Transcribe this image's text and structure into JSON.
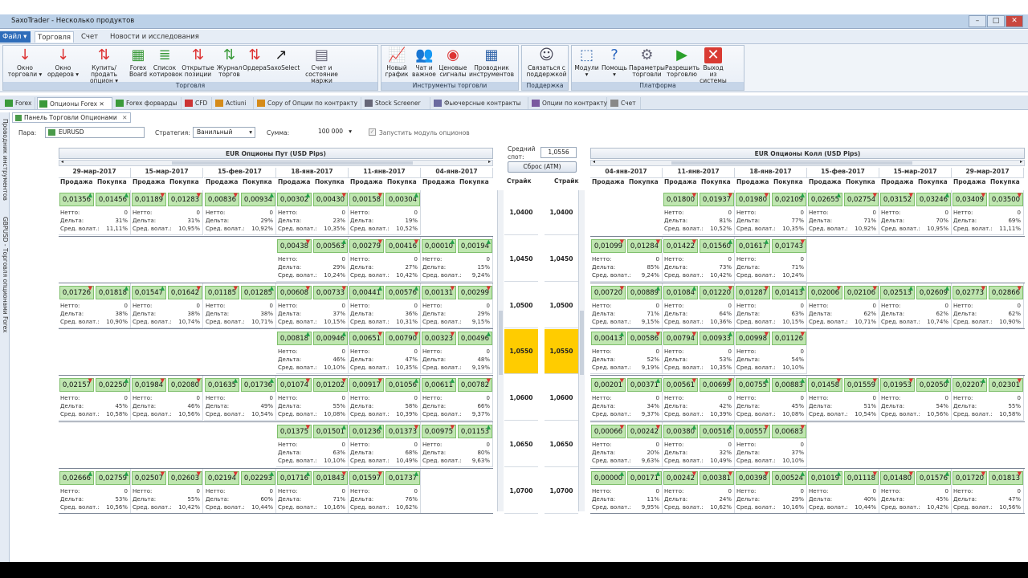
{
  "window": {
    "title": "SaxoTrader - Несколько продуктов"
  },
  "menu": {
    "file": "Файл",
    "items": [
      "Торговля",
      "Счет",
      "Новости и исследования"
    ]
  },
  "ribbon": {
    "groups": [
      {
        "label": "Торговля",
        "buttons": [
          {
            "l1": "Окно",
            "l2": "торговли ▾",
            "icon": "↓",
            "color": "#d33"
          },
          {
            "l1": "Окно",
            "l2": "ордеров ▾",
            "icon": "↓",
            "color": "#d33"
          },
          {
            "l1": "Купить/продать",
            "l2": "опцион ▾",
            "icon": "⇅",
            "color": "#d33"
          },
          {
            "l1": "Forex",
            "l2": "Board",
            "icon": "▦",
            "color": "#3a9a3a"
          },
          {
            "l1": "Список",
            "l2": "котировок",
            "icon": "≣",
            "color": "#3a9a3a"
          },
          {
            "l1": "Открытые",
            "l2": "позиции",
            "icon": "⇅",
            "color": "#d33"
          },
          {
            "l1": "Журнал",
            "l2": "торгов",
            "icon": "⇅",
            "color": "#3a9a3a"
          },
          {
            "l1": "Ордера",
            "l2": "",
            "icon": "⇅",
            "color": "#d33"
          },
          {
            "l1": "SaxoSelect",
            "l2": "",
            "icon": "↗",
            "color": "#222"
          },
          {
            "l1": "Счет и",
            "l2": "состояние маржи",
            "icon": "▤",
            "color": "#667"
          }
        ]
      },
      {
        "label": "Инструменты торговли",
        "buttons": [
          {
            "l1": "Новый",
            "l2": "график",
            "icon": "📈",
            "color": "#c33"
          },
          {
            "l1": "Чат и",
            "l2": "важное",
            "icon": "👥",
            "color": "#444"
          },
          {
            "l1": "Ценовые",
            "l2": "сигналы",
            "icon": "◉",
            "color": "#d33"
          },
          {
            "l1": "Проводник",
            "l2": "инструментов",
            "icon": "▦",
            "color": "#3366aa"
          }
        ]
      },
      {
        "label": "Поддержка",
        "buttons": [
          {
            "l1": "Связаться с",
            "l2": "поддержкой",
            "icon": "☺",
            "color": "#445"
          }
        ]
      },
      {
        "label": "Платформа",
        "buttons": [
          {
            "l1": "Модули",
            "l2": "▾",
            "icon": "⬚",
            "color": "#3366aa"
          },
          {
            "l1": "Помощь",
            "l2": "▾",
            "icon": "?",
            "color": "#2a66c0"
          },
          {
            "l1": "Параметры",
            "l2": "торговли",
            "icon": "⚙",
            "color": "#667"
          },
          {
            "l1": "Разрешить",
            "l2": "торговлю",
            "icon": "▶",
            "color": "#2aa02a"
          },
          {
            "l1": "Выход из",
            "l2": "системы",
            "icon": "✕",
            "color": "#fff"
          }
        ]
      }
    ]
  },
  "tabs": [
    "Forex",
    "Опционы Forex",
    "Forex форварды",
    "CFD",
    "Actiuni",
    "Copy of Опции по контракту",
    "Stock Screener",
    "Фьючерсные контракты",
    "Опции по контракту",
    "Счет"
  ],
  "subtab": "Панель Торговли Опционами",
  "sidebar": {
    "t1": "Проводник инструментов",
    "t2": "GBPUSD - Торговля опционами Forex"
  },
  "params": {
    "pair_label": "Пара:",
    "pair": "EURUSD",
    "strategy_label": "Стратегия:",
    "strategy": "Ванильный",
    "amount_label": "Сумма:",
    "amount": "100 000",
    "run_label": "Запустить модуль опционов"
  },
  "spot": {
    "label1": "Средний",
    "label2": "спот:",
    "value": "1,0556",
    "reset": "Сброс (ATM)"
  },
  "puts": {
    "title": "EUR Опционы Пут (USD Pips)",
    "dates": [
      "29-мар-2017",
      "15-мар-2017",
      "15-фев-2017",
      "18-янв-2017",
      "11-янв-2017",
      "04-янв-2017"
    ]
  },
  "calls": {
    "title": "EUR Опционы Колл (USD Pips)",
    "dates": [
      "04-янв-2017",
      "11-янв-2017",
      "18-янв-2017",
      "15-фев-2017",
      "15-мар-2017",
      "29-мар-2017"
    ]
  },
  "labels": {
    "sell": "Продажа",
    "buy": "Покупка",
    "strike": "Страйк",
    "netto": "Нетто:",
    "delta": "Дельта:",
    "vol": "Сред. волат.:"
  },
  "strikes": [
    "1,0400",
    "1,0450",
    "1,0500",
    "1,0550",
    "1,0600",
    "1,0650",
    "1,0700"
  ],
  "put_rows": [
    [
      [
        "0,01356",
        "0,01456",
        "0",
        "31%",
        "11,11%"
      ],
      [
        "0,01189",
        "0,01283",
        "0",
        "31%",
        "10,95%"
      ],
      [
        "0,00836",
        "0,00934",
        "0",
        "29%",
        "10,92%"
      ],
      [
        "0,00302",
        "0,00430",
        "0",
        "23%",
        "10,35%"
      ],
      [
        "0,00158",
        "0,00304",
        "0",
        "19%",
        "10,52%"
      ],
      null
    ],
    [
      null,
      null,
      null,
      [
        "0,00438",
        "0,00563",
        "0",
        "29%",
        "10,24%"
      ],
      [
        "0,00279",
        "0,00416",
        "0",
        "27%",
        "10,42%"
      ],
      [
        "0,00010",
        "0,00194",
        "0",
        "15%",
        "9,24%"
      ]
    ],
    [
      [
        "0,01726",
        "0,01818",
        "0",
        "38%",
        "10,90%"
      ],
      [
        "0,01547",
        "0,01642",
        "0",
        "38%",
        "10,74%"
      ],
      [
        "0,01185",
        "0,01285",
        "0",
        "38%",
        "10,71%"
      ],
      [
        "0,00608",
        "0,00733",
        "0",
        "37%",
        "10,15%"
      ],
      [
        "0,00441",
        "0,00576",
        "0",
        "36%",
        "10,31%"
      ],
      [
        "0,00131",
        "0,00299",
        "0",
        "29%",
        "9,15%"
      ]
    ],
    [
      null,
      null,
      null,
      [
        "0,00818",
        "0,00946",
        "0",
        "46%",
        "10,10%"
      ],
      [
        "0,00651",
        "0,00790",
        "0",
        "47%",
        "10,35%"
      ],
      [
        "0,00323",
        "0,00496",
        "0",
        "48%",
        "9,19%"
      ]
    ],
    [
      [
        "0,02157",
        "0,02250",
        "0",
        "45%",
        "10,58%"
      ],
      [
        "0,01984",
        "0,02080",
        "0",
        "46%",
        "10,56%"
      ],
      [
        "0,01635",
        "0,01736",
        "0",
        "49%",
        "10,54%"
      ],
      [
        "0,01074",
        "0,01202",
        "0",
        "55%",
        "10,08%"
      ],
      [
        "0,00917",
        "0,01056",
        "0",
        "58%",
        "10,39%"
      ],
      [
        "0,00611",
        "0,00782",
        "0",
        "66%",
        "9,37%"
      ]
    ],
    [
      null,
      null,
      null,
      [
        "0,01375",
        "0,01501",
        "0",
        "63%",
        "10,10%"
      ],
      [
        "0,01236",
        "0,01373",
        "0",
        "68%",
        "10,49%"
      ],
      [
        "0,00975",
        "0,01153",
        "0",
        "80%",
        "9,63%"
      ]
    ],
    [
      [
        "0,02666",
        "0,02759",
        "0",
        "53%",
        "10,56%"
      ],
      [
        "0,02507",
        "0,02603",
        "0",
        "55%",
        "10,42%"
      ],
      [
        "0,02194",
        "0,02293",
        "0",
        "60%",
        "10,44%"
      ],
      [
        "0,01716",
        "0,01843",
        "0",
        "71%",
        "10,16%"
      ],
      [
        "0,01597",
        "0,01737",
        "0",
        "76%",
        "10,62%"
      ],
      null
    ]
  ],
  "call_rows": [
    [
      null,
      [
        "0,01800",
        "0,01937",
        "0",
        "81%",
        "10,52%"
      ],
      [
        "0,01980",
        "0,02109",
        "0",
        "77%",
        "10,35%"
      ],
      [
        "0,02655",
        "0,02754",
        "0",
        "71%",
        "10,92%"
      ],
      [
        "0,03152",
        "0,03246",
        "0",
        "70%",
        "10,95%"
      ],
      [
        "0,03409",
        "0,03500",
        "0",
        "69%",
        "11,11%"
      ]
    ],
    [
      [
        "0,01099",
        "0,01284",
        "0",
        "85%",
        "9,24%"
      ],
      [
        "0,01422",
        "0,01560",
        "0",
        "73%",
        "10,42%"
      ],
      [
        "0,01617",
        "0,01743",
        "0",
        "71%",
        "10,24%"
      ],
      null,
      null,
      null
    ],
    [
      [
        "0,00720",
        "0,00889",
        "0",
        "71%",
        "9,15%"
      ],
      [
        "0,01084",
        "0,01220",
        "0",
        "64%",
        "10,36%"
      ],
      [
        "0,01287",
        "0,01413",
        "0",
        "63%",
        "10,15%"
      ],
      [
        "0,02006",
        "0,02106",
        "0",
        "62%",
        "10,71%"
      ],
      [
        "0,02513",
        "0,02609",
        "0",
        "62%",
        "10,74%"
      ],
      [
        "0,02773",
        "0,02866",
        "0",
        "62%",
        "10,90%"
      ]
    ],
    [
      [
        "0,00413",
        "0,00586",
        "0",
        "52%",
        "9,19%"
      ],
      [
        "0,00794",
        "0,00933",
        "0",
        "53%",
        "10,35%"
      ],
      [
        "0,00998",
        "0,01126",
        "0",
        "54%",
        "10,10%"
      ],
      null,
      null,
      null
    ],
    [
      [
        "0,00201",
        "0,00371",
        "0",
        "34%",
        "9,37%"
      ],
      [
        "0,00561",
        "0,00699",
        "0",
        "42%",
        "10,39%"
      ],
      [
        "0,00755",
        "0,00883",
        "0",
        "45%",
        "10,08%"
      ],
      [
        "0,01458",
        "0,01559",
        "0",
        "51%",
        "10,54%"
      ],
      [
        "0,01953",
        "0,02050",
        "0",
        "54%",
        "10,56%"
      ],
      [
        "0,02207",
        "0,02301",
        "0",
        "55%",
        "10,58%"
      ]
    ],
    [
      [
        "0,00066",
        "0,00242",
        "0",
        "20%",
        "9,63%"
      ],
      [
        "0,00380",
        "0,00516",
        "0",
        "32%",
        "10,49%"
      ],
      [
        "0,00557",
        "0,00683",
        "0",
        "37%",
        "10,10%"
      ],
      null,
      null,
      null
    ],
    [
      [
        "0,00000",
        "0,00171",
        "0",
        "11%",
        "9,95%"
      ],
      [
        "0,00242",
        "0,00381",
        "0",
        "24%",
        "10,62%"
      ],
      [
        "0,00398",
        "0,00524",
        "0",
        "29%",
        "10,16%"
      ],
      [
        "0,01019",
        "0,01118",
        "0",
        "40%",
        "10,44%"
      ],
      [
        "0,01480",
        "0,01576",
        "0",
        "45%",
        "10,42%"
      ],
      [
        "0,01720",
        "0,01813",
        "0",
        "47%",
        "10,56%"
      ]
    ]
  ],
  "colors": {
    "quote_bg": "#bfe6b0",
    "atm": "#ffcc00",
    "up_arrow": "#22a14a",
    "down_arrow": "#dd3333"
  }
}
